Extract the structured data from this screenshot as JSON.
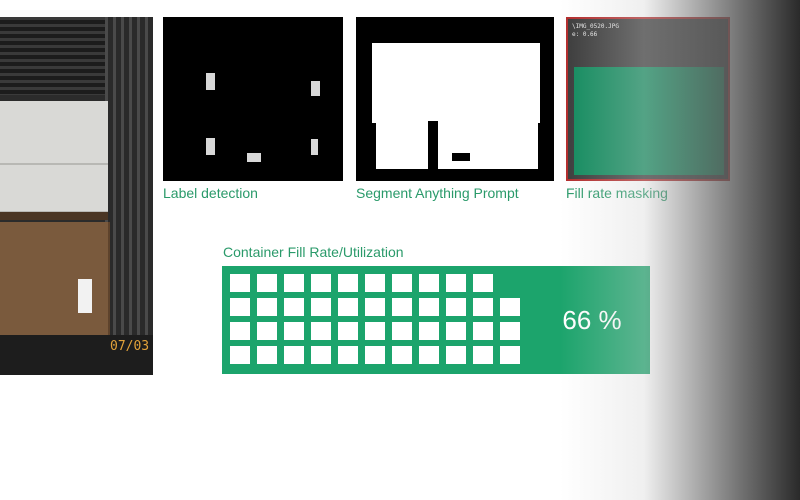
{
  "photo": {
    "date_stamp": "07/03"
  },
  "panels": {
    "label_detection": {
      "caption": "Label detection"
    },
    "segment_anything": {
      "caption": "Segment Anything Prompt"
    },
    "fill_rate_masking": {
      "caption": "Fill rate masking",
      "overlay_line1": "\\IMG_0520.JPG",
      "overlay_line2": "e: 0.66"
    }
  },
  "utilization": {
    "title": "Container Fill Rate/Utilization",
    "percent_label": "66 %",
    "fill_fraction": 0.66
  },
  "colors": {
    "accent": "#1ca46c",
    "caption": "#2a9a6a",
    "mask_border": "#b22a2a"
  }
}
